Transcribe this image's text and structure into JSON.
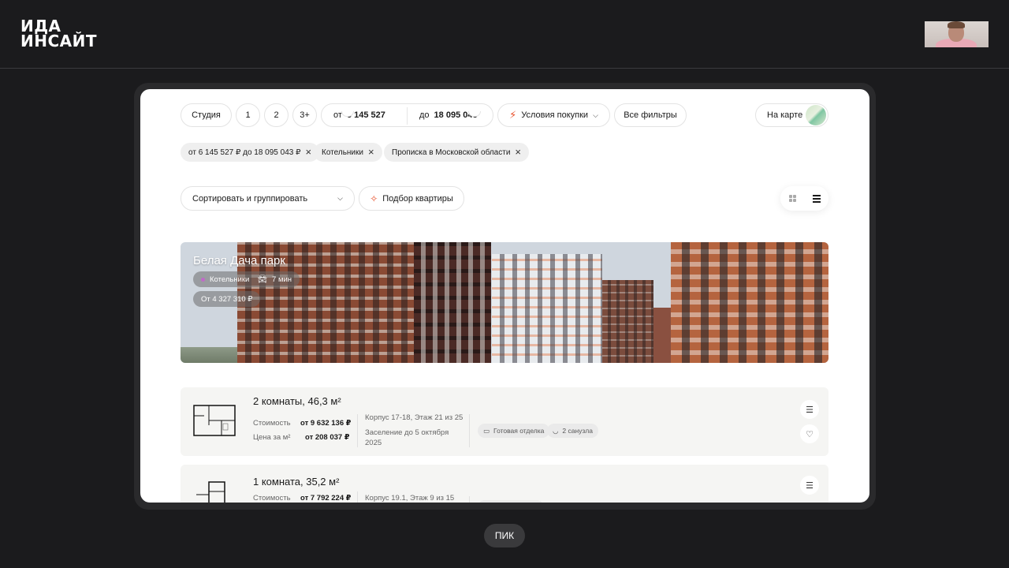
{
  "logo": {
    "line1": "ИДА",
    "line2": "ИНСАЙТ"
  },
  "filters": {
    "room_options": [
      "Студия",
      "1",
      "2",
      "3+"
    ],
    "price_from_label": "от",
    "price_from": "6 145 527",
    "price_to_label": "до",
    "price_to": "18 095 043",
    "purchase_conditions": "Условия покупки",
    "all_filters": "Все фильтры",
    "on_map": "На карте"
  },
  "active_tags": [
    "от 6 145 527 ₽ до 18 095 043 ₽",
    "Котельники",
    "Прописка в Московской области"
  ],
  "controls": {
    "sort_label": "Сортировать и группировать",
    "pick_label": "Подбор квартиры"
  },
  "complex": {
    "name": "Белая Дача парк",
    "metro": "Котельники",
    "travel_time": "7 мин",
    "price_from": "От 4 327 310 ₽"
  },
  "apartments": [
    {
      "title": "2 комнаты, 46,3 м²",
      "cost_label": "Стоимость",
      "cost": "от 9 632 136 ₽",
      "per_m2_label": "Цена за м²",
      "per_m2": "от 208 037 ₽",
      "building": "Корпус 17-18, Этаж 21 из 25",
      "move_in": "Заселение до 5 октября 2025",
      "features": [
        "Готовая отделка",
        "2 санузла"
      ]
    },
    {
      "title": "1 комната, 35,2 м²",
      "cost_label": "Стоимость",
      "cost": "от 7 792 224 ₽",
      "building": "Корпус 19.1, Этаж 9 из 15"
    }
  ],
  "footer_label": "ПИК"
}
